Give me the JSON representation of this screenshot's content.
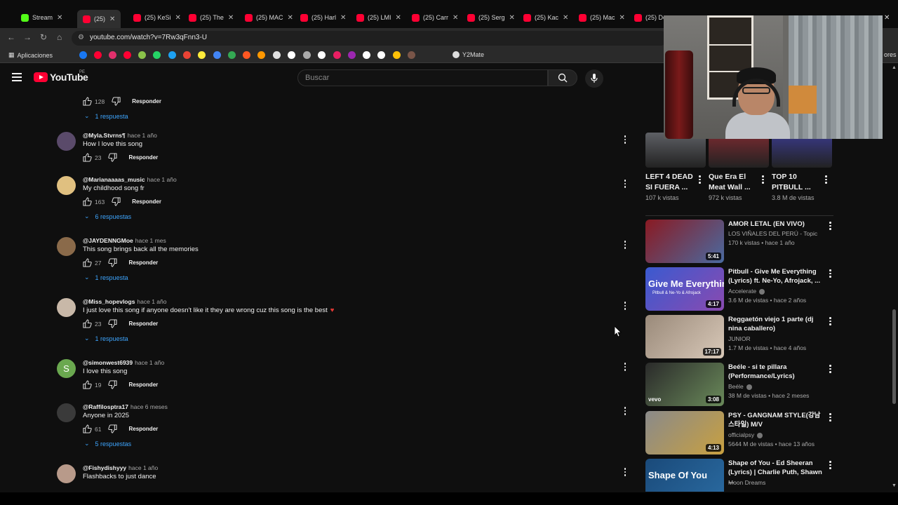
{
  "browser": {
    "tabs": [
      {
        "label": "Stream",
        "color": "#53fc18"
      },
      {
        "label": "(25)",
        "color": "#ff0033",
        "active": true
      },
      {
        "label": "(25) KeSi",
        "color": "#ff0033"
      },
      {
        "label": "(25) The",
        "color": "#ff0033"
      },
      {
        "label": "(25) MAC",
        "color": "#ff0033"
      },
      {
        "label": "(25) Harl",
        "color": "#ff0033"
      },
      {
        "label": "(25) LMI",
        "color": "#ff0033"
      },
      {
        "label": "(25) Carr",
        "color": "#ff0033"
      },
      {
        "label": "(25) Serg",
        "color": "#ff0033"
      },
      {
        "label": "(25) Kac",
        "color": "#ff0033"
      },
      {
        "label": "(25) Mac",
        "color": "#ff0033"
      },
      {
        "label": "(25) Do",
        "color": "#ff0033"
      }
    ],
    "url": "youtube.com/watch?v=7Rw3qFnn3-U",
    "bookmarks_apps_label": "Aplicaciones",
    "bookmarks_y2mate": "Y2Mate",
    "bookmarks_right": "ores"
  },
  "header": {
    "logo_text": "YouTube",
    "country": "PE",
    "search_placeholder": "Buscar"
  },
  "comments": {
    "top_partial": {
      "likes": "128",
      "reply_label": "Responder",
      "replies": "1 respuesta"
    },
    "items": [
      {
        "author": "@Myla.Stvrns¶",
        "time": "hace 1 año",
        "text": "How I love this song",
        "likes": "23",
        "reply_label": "Responder",
        "replies": "",
        "avatar_color": "#5a4a6a"
      },
      {
        "author": "@Marianaaaas_music",
        "time": "hace 1 año",
        "text": "My childhood song fr",
        "likes": "163",
        "reply_label": "Responder",
        "replies": "6 respuestas",
        "avatar_color": "#e0c080"
      },
      {
        "author": "@JAYDENNGMoe",
        "time": "hace 1 mes",
        "text": "This song brings back all the memories",
        "likes": "27",
        "reply_label": "Responder",
        "replies": "1 respuesta",
        "avatar_color": "#8a6a4a"
      },
      {
        "author": "@Miss_hopevlogs",
        "time": "hace 1 año",
        "text": "I just love this song if anyone doesn't like it they are wrong cuz this song is the best",
        "heart": "♥",
        "likes": "23",
        "reply_label": "Responder",
        "replies": "1 respuesta",
        "avatar_color": "#c8b8a8"
      },
      {
        "author": "@simonwest6939",
        "time": "hace 1 año",
        "text": "I love this song",
        "likes": "19",
        "reply_label": "Responder",
        "replies": "",
        "avatar_color": "#6aa84f",
        "avatar_letter": "S"
      },
      {
        "author": "@Raffilosptra17",
        "time": "hace 6 meses",
        "text": "Anyone in 2025",
        "likes": "61",
        "reply_label": "Responder",
        "replies": "5 respuestas",
        "avatar_color": "#3a3a3a"
      },
      {
        "author": "@Fishydishyyy",
        "time": "hace 1 año",
        "text": "Flashbacks to just dance",
        "likes": "",
        "reply_label": "",
        "replies": "",
        "avatar_color": "#b89a8a"
      }
    ]
  },
  "sidebar": {
    "shorts": [
      {
        "title1": "LEFT 4 DEAD",
        "title2": "SI FUERA ...",
        "views": "107 k vistas",
        "thumb": "#5e6065"
      },
      {
        "title1": "Que Era El",
        "title2": "Meat  Wall ...",
        "views": "972 k vistas",
        "thumb": "#7a2a30"
      },
      {
        "title1": "TOP 10",
        "title2": "PITBULL ...",
        "views": "3.8 M de vistas",
        "thumb": "#3a3a8a"
      }
    ],
    "videos": [
      {
        "title": "AMOR LETAL (EN VIVO)",
        "channel": "LOS VIÑALES DEL PERÚ - Topic",
        "verified": false,
        "meta": "170 k vistas • hace 1 año",
        "duration": "5:41",
        "thumb": "#8a1a22",
        "thumb2": "#4a6aa0",
        "lines": 1
      },
      {
        "title": "Pitbull - Give Me Everything (Lyrics) ft. Ne-Yo, Afrojack, ...",
        "channel": "Accelerate",
        "verified": true,
        "meta": "3.6 M de vistas • hace 2 años",
        "duration": "4:17",
        "thumb": "#3a5ad0",
        "thumb2": "#8a4ab0",
        "lines": 2,
        "thumb_text": "Give Me Everything",
        "thumb_sub": "Pitbull & Ne-Yo & Afrojack"
      },
      {
        "title": "Reggaetón viejo 1 parte (dj nina caballero)",
        "channel": "JUNIOR",
        "verified": false,
        "meta": "1.7 M de vistas • hace 4 años",
        "duration": "17:17",
        "thumb": "#9a8a7a",
        "thumb2": "#d8c8b8",
        "lines": 2
      },
      {
        "title": "Beéle - si te pillara (Performance/Lyrics)",
        "channel": "Beéle",
        "verified": true,
        "meta": "38 M de vistas • hace 2 meses",
        "duration": "3:08",
        "thumb": "#2a2a2a",
        "thumb2": "#6a8a5a",
        "lines": 2,
        "thumb_text": "vevo"
      },
      {
        "title": "PSY - GANGNAM STYLE(강남스타일) M/V",
        "channel": "officialpsy",
        "verified": true,
        "meta": "5644 M de vistas • hace 13 años",
        "duration": "4:13",
        "thumb": "#8a8a8a",
        "thumb2": "#c8a040",
        "lines": 2
      },
      {
        "title": "Shape of You - Ed Sheeran (Lyrics) | Charlie Puth, Shawn ...",
        "channel": "Moon Dreams",
        "verified": false,
        "meta": "",
        "duration": "",
        "thumb": "#1a4a7a",
        "thumb2": "#2a6aa0",
        "lines": 2,
        "thumb_text": "Shape Of You"
      }
    ]
  },
  "colors": {
    "accent_link": "#3ea6ff",
    "brand_red": "#ff0033",
    "bg": "#0f0f0f"
  },
  "icons": [
    "menu-icon",
    "search-icon",
    "mic-icon",
    "like-icon",
    "dislike-icon",
    "more-vert-icon",
    "chevron-down-icon",
    "verified-icon",
    "close-icon"
  ]
}
